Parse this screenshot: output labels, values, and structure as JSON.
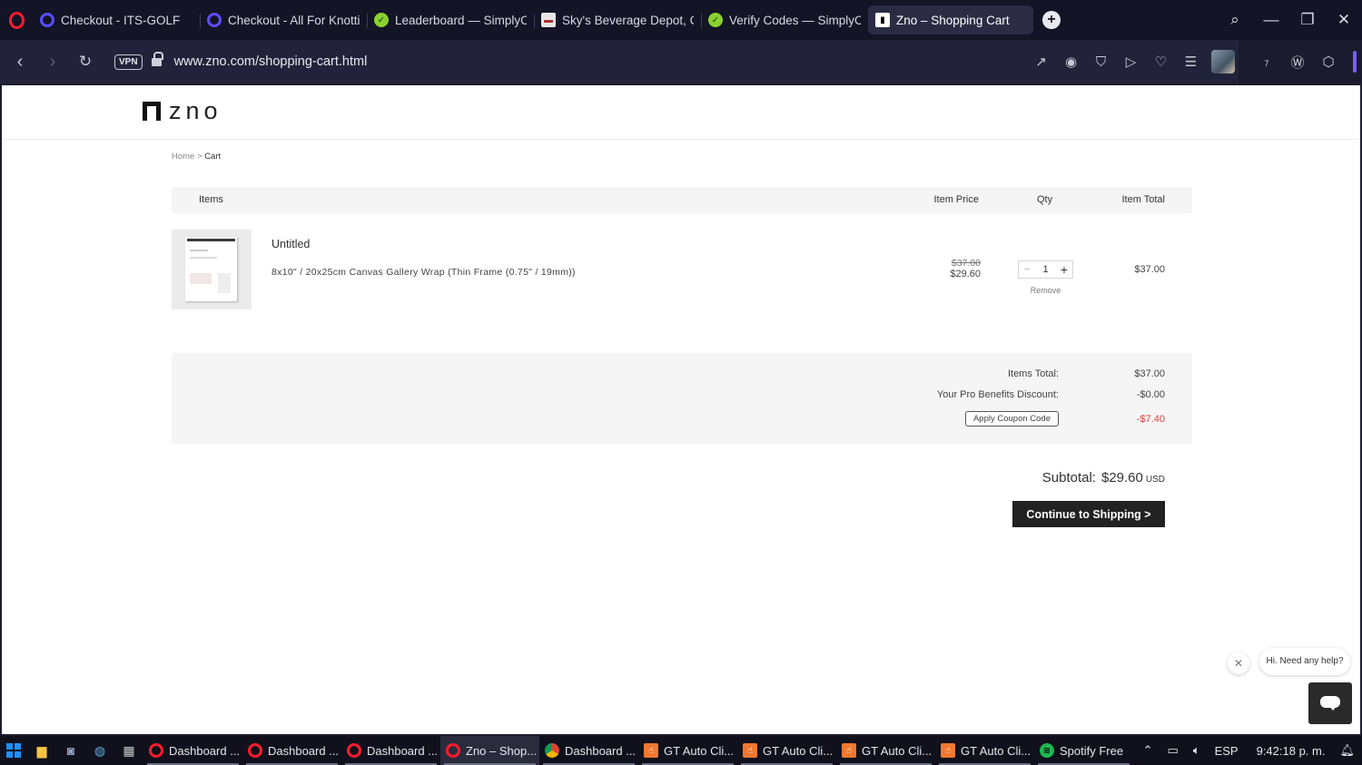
{
  "browser": {
    "tabs": [
      {
        "title": "Checkout - ITS-GOLF",
        "icon": "opera-icon",
        "active": false
      },
      {
        "title": "Checkout - All For Knotting",
        "icon": "opera-icon",
        "active": false
      },
      {
        "title": "Leaderboard — SimplyCodes",
        "icon": "simplycodes-icon",
        "active": false
      },
      {
        "title": "Sky's Beverage Depot, Chicago",
        "icon": "sky-icon",
        "active": false
      },
      {
        "title": "Verify Codes — SimplyCodes",
        "icon": "simplycodes-icon",
        "active": false
      },
      {
        "title": "Zno – Shopping Cart",
        "icon": "zno-icon",
        "active": true
      }
    ],
    "new_tab": "+",
    "vpn_label": "VPN",
    "url": "www.zno.com/shopping-cart.html",
    "extension_badge": "7"
  },
  "site": {
    "logo_text": "zno",
    "breadcrumb": {
      "home": "Home",
      "separator": ">",
      "current": "Cart"
    },
    "table_headers": {
      "items": "Items",
      "price": "Item Price",
      "qty": "Qty",
      "total": "Item Total"
    },
    "item": {
      "name": "Untitled",
      "description": "8x10\" / 20x25cm Canvas Gallery Wrap (Thin Frame (0.75\" / 19mm))",
      "original_price": "$37.00",
      "price": "$29.60",
      "qty": "1",
      "qty_minus": "−",
      "qty_plus": "+",
      "remove": "Remove",
      "total": "$37.00"
    },
    "summary": {
      "items_total_label": "Items Total:",
      "items_total_value": "$37.00",
      "pro_discount_label": "Your Pro Benefits Discount:",
      "pro_discount_value": "-$0.00",
      "coupon_label": "Apply Coupon Code",
      "coupon_value": "-$7.40"
    },
    "subtotal_label": "Subtotal:",
    "subtotal_value": "$29.60",
    "subtotal_currency": "USD",
    "continue_button": "Continue to Shipping >",
    "help_text": "Hi. Need any help?",
    "help_close": "✕"
  },
  "taskbar": {
    "apps": [
      {
        "label": "Dashboard ...",
        "icon": "opera-icon",
        "active": false
      },
      {
        "label": "Dashboard ...",
        "icon": "opera-icon",
        "active": false
      },
      {
        "label": "Dashboard ...",
        "icon": "opera-icon",
        "active": false
      },
      {
        "label": "Zno – Shop...",
        "icon": "opera-icon",
        "active": true
      },
      {
        "label": "Dashboard ...",
        "icon": "chrome-icon",
        "active": false
      },
      {
        "label": "GT Auto Cli...",
        "icon": "gt-auto-clicker-icon",
        "active": false
      },
      {
        "label": "GT Auto Cli...",
        "icon": "gt-auto-clicker-icon",
        "active": false
      },
      {
        "label": "GT Auto Cli...",
        "icon": "gt-auto-clicker-icon",
        "active": false
      },
      {
        "label": "GT Auto Cli...",
        "icon": "gt-auto-clicker-icon",
        "active": false
      },
      {
        "label": "Spotify Free",
        "icon": "spotify-icon",
        "active": false
      }
    ],
    "language": "ESP",
    "clock": "9:42:18 p. m."
  },
  "colors": {
    "accent_red": "#e0413a",
    "button_dark": "#222222",
    "browser_bg": "#131426"
  }
}
